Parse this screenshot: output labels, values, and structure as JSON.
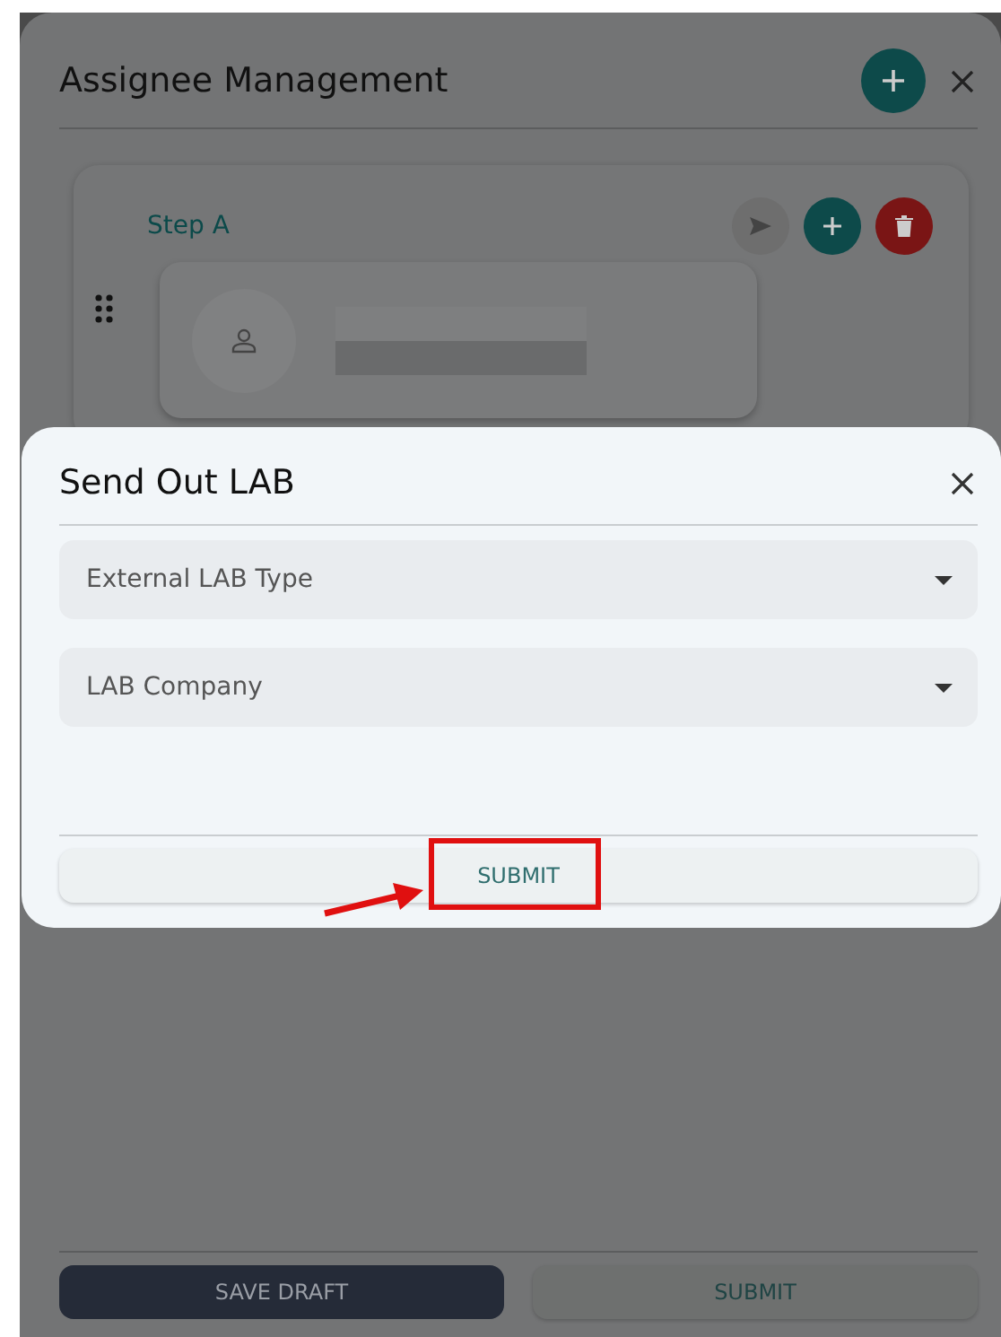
{
  "panel": {
    "title": "Assignee Management"
  },
  "step": {
    "label": "Step A",
    "actions": [
      {
        "kind": "send",
        "disabled": true
      },
      {
        "kind": "add",
        "disabled": false
      },
      {
        "kind": "delete",
        "disabled": false
      }
    ]
  },
  "footer": {
    "buttons": [
      {
        "label": "SAVE DRAFT",
        "kind": "primary"
      },
      {
        "label": "SUBMIT",
        "kind": "secondary"
      }
    ]
  },
  "dialog": {
    "title": "Send Out LAB",
    "fields": [
      {
        "placeholder": "External LAB Type"
      },
      {
        "placeholder": "LAB Company"
      }
    ],
    "submit": "SUBMIT"
  }
}
